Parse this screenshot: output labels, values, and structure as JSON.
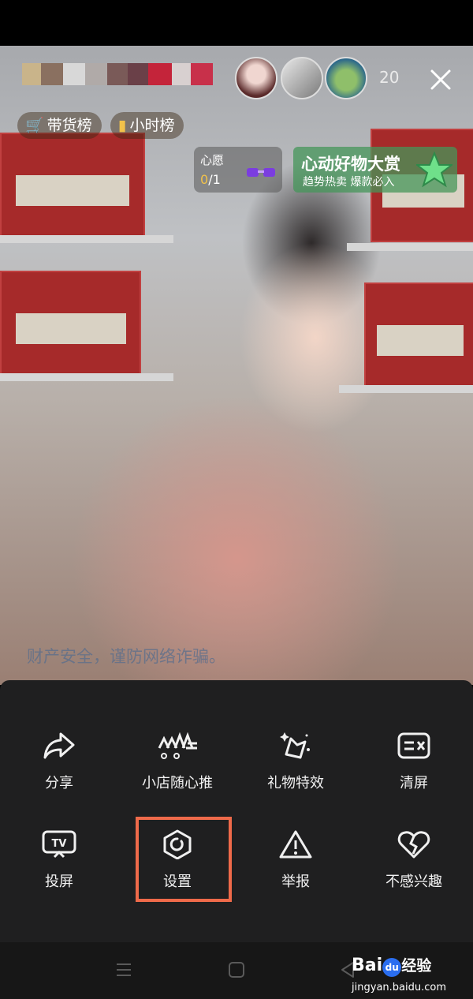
{
  "header": {
    "viewer_count": "20",
    "close_icon": "close-icon"
  },
  "rank_pills": [
    {
      "label": "带货榜",
      "icon": "cart-icon",
      "glyph": "🛒"
    },
    {
      "label": "小时榜",
      "icon": "bar-chart-icon",
      "glyph": "▮"
    }
  ],
  "wish": {
    "title": "心愿",
    "count_current": "0",
    "count_total": "/1"
  },
  "banner": {
    "title": "心动好物大赏",
    "subtitle": "趋势热卖 爆款必入"
  },
  "warning_text": "财产安全，谨防网络诈骗。",
  "menu": {
    "items": [
      {
        "label": "分享",
        "icon": "share-icon"
      },
      {
        "label": "小店随心推",
        "icon": "shop-promote-icon"
      },
      {
        "label": "礼物特效",
        "icon": "gift-effect-icon"
      },
      {
        "label": "清屏",
        "icon": "clear-screen-icon"
      },
      {
        "label": "投屏",
        "icon": "cast-screen-icon"
      },
      {
        "label": "设置",
        "icon": "settings-icon"
      },
      {
        "label": "举报",
        "icon": "report-icon"
      },
      {
        "label": "不感兴趣",
        "icon": "not-interested-icon"
      }
    ]
  },
  "watermark": {
    "brand": "Bai",
    "paw": "du",
    "suffix": "经验",
    "url": "jingyan.baidu.com"
  },
  "colors": {
    "sheet_bg": "#1f1f20",
    "highlight": "#ef6a4a",
    "rank_icon": "#f2c24a"
  }
}
